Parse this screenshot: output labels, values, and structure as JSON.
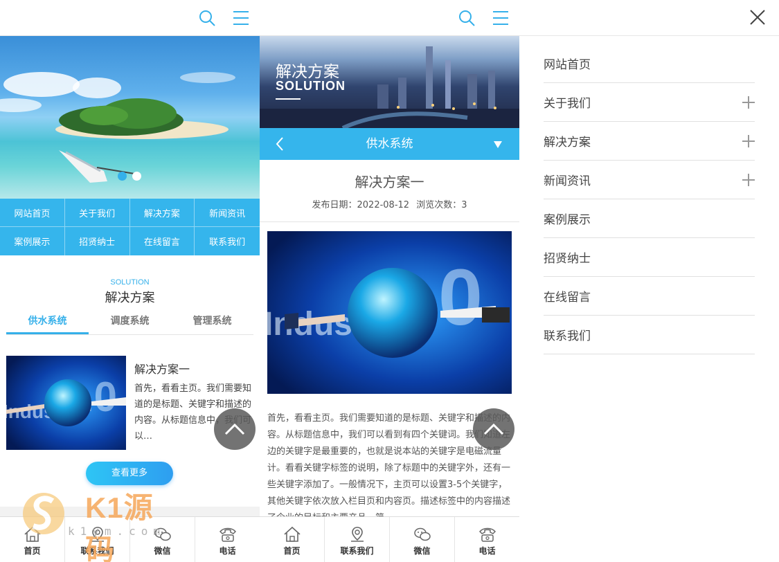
{
  "panel1": {
    "nav": [
      "网站首页",
      "关于我们",
      "解决方案",
      "新闻资讯",
      "案例展示",
      "招贤纳士",
      "在线留言",
      "联系我们"
    ],
    "section_en": "SOLUTION",
    "section_cn": "解决方案",
    "tabs": [
      "供水系统",
      "调度系统",
      "管理系统"
    ],
    "item": {
      "title": "解决方案一",
      "desc": "首先，看看主页。我们需要知道的是标题、关键字和描述的内容。从标题信息中，我们可以…"
    },
    "more_label": "查看更多",
    "watermark": {
      "brand": "K1源码",
      "sub": "k1ym.com"
    }
  },
  "panel2": {
    "banner_cn": "解决方案",
    "banner_en": "SOLUTION",
    "subnav_title": "供水系统",
    "article": {
      "title": "解决方案一",
      "date_label": "发布日期：2022-08-12",
      "views_label": "浏览次数：3",
      "body": "首先，看看主页。我们需要知道的是标题、关键字和描述的内容。从标题信息中，我们可以看到有四个关键词。我们知道左边的关键字是最重要的，也就是说本站的关键字是电磁流量计。看看关键字标签的说明，除了标题中的关键字外，还有一些关键字添加了。一般情况下，主页可以设置3-5个关键字，其他关键字依次放入栏目页和内容页。描述标签中的内容描述了企业的目标和主要产品，简"
    }
  },
  "footer": [
    {
      "label": "首页",
      "icon": "home-icon"
    },
    {
      "label": "联系我们",
      "icon": "location-icon"
    },
    {
      "label": "微信",
      "icon": "wechat-icon"
    },
    {
      "label": "电话",
      "icon": "phone-icon"
    }
  ],
  "menu": [
    {
      "label": "网站首页",
      "expandable": false
    },
    {
      "label": "关于我们",
      "expandable": true
    },
    {
      "label": "解决方案",
      "expandable": true
    },
    {
      "label": "新闻资讯",
      "expandable": true
    },
    {
      "label": "案例展示",
      "expandable": false
    },
    {
      "label": "招贤纳士",
      "expandable": false
    },
    {
      "label": "在线留言",
      "expandable": false
    },
    {
      "label": "联系我们",
      "expandable": false
    }
  ],
  "colors": {
    "accent": "#35b5ec",
    "text": "#333333",
    "watermark": "#f6a75a"
  }
}
